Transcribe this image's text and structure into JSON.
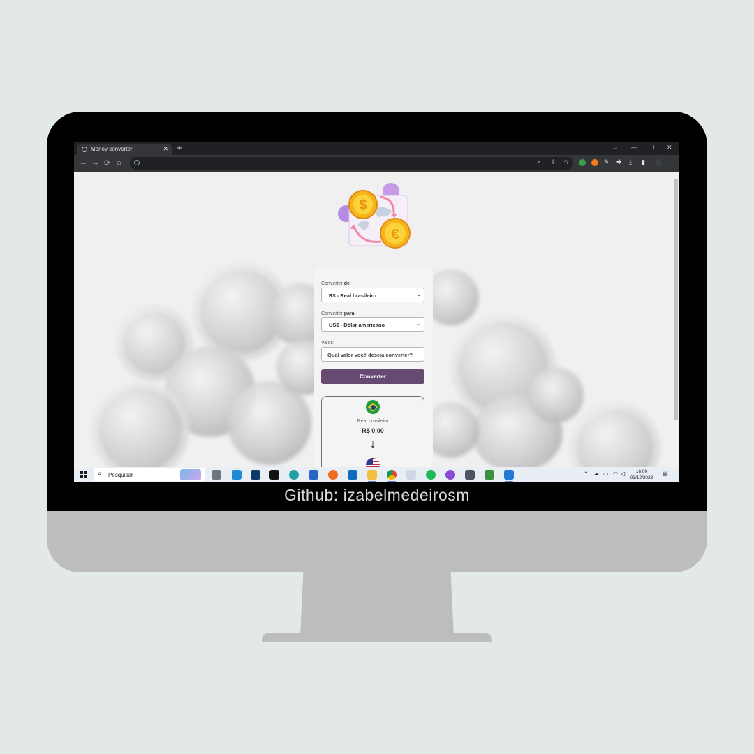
{
  "caption": "Github: izabelmedeirosm",
  "browser": {
    "tab_title": "Money converter",
    "tab_close": "✕",
    "new_tab": "+",
    "window_controls": [
      "⌄",
      "—",
      "❐",
      "✕"
    ],
    "url": ""
  },
  "form": {
    "from_label_prefix": "Converter ",
    "from_label_emph": "de",
    "from_selected": "R$ - Real brasileiro",
    "to_label_prefix": "Converter ",
    "to_label_emph": "para",
    "to_selected": "US$ - Dólar americano",
    "value_label": "Valor:",
    "value_placeholder": "Qual valor você deseja converter?",
    "convert_button": "Converter"
  },
  "result": {
    "from_currency_name": "Real brasileiro",
    "from_value": "R$ 0,00",
    "arrow": "↓"
  },
  "taskbar": {
    "search_placeholder": "Pesquisar",
    "time": "16:00",
    "date": "03/12/2023"
  },
  "colors": {
    "accent": "#664a71",
    "background": "#e3e9e8",
    "bezel": "#000000",
    "monitor_body": "#bdbdbd"
  }
}
